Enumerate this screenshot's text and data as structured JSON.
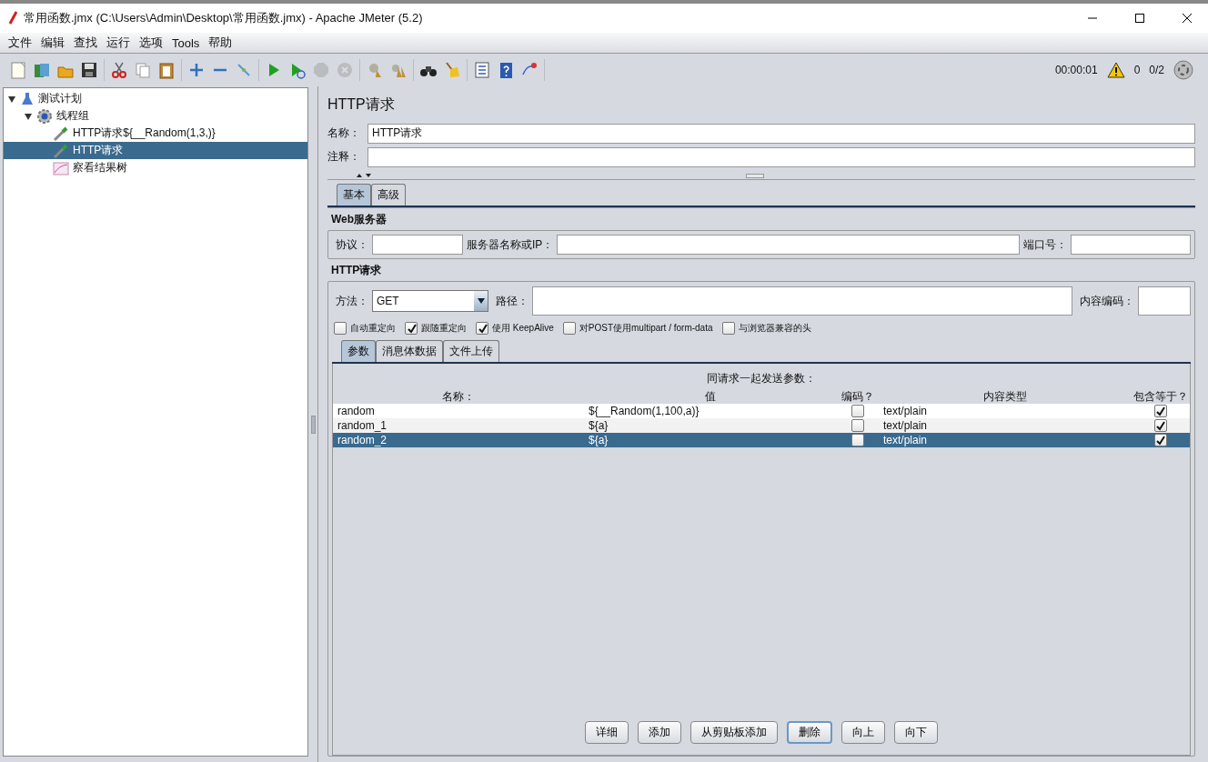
{
  "window": {
    "title": "常用函数.jmx (C:\\Users\\Admin\\Desktop\\常用函数.jmx) - Apache JMeter (5.2)"
  },
  "menu": [
    "文件",
    "编辑",
    "查找",
    "运行",
    "选项",
    "Tools",
    "帮助"
  ],
  "toolbar": [
    {
      "items": [
        {
          "kind": "new",
          "disabled": false
        },
        {
          "kind": "templates",
          "disabled": false
        },
        {
          "kind": "open",
          "disabled": false
        },
        {
          "kind": "save",
          "disabled": false
        }
      ]
    },
    {
      "items": [
        {
          "kind": "cut",
          "disabled": false
        },
        {
          "kind": "copy",
          "disabled": false
        },
        {
          "kind": "paste",
          "disabled": false
        }
      ]
    },
    {
      "items": [
        {
          "kind": "expand",
          "disabled": false
        },
        {
          "kind": "collapse",
          "disabled": false
        },
        {
          "kind": "toggle",
          "disabled": false
        }
      ]
    },
    {
      "items": [
        {
          "kind": "start",
          "disabled": false
        },
        {
          "kind": "start-no-timers",
          "disabled": false
        },
        {
          "kind": "stop",
          "disabled": true
        },
        {
          "kind": "shutdown",
          "disabled": true
        }
      ]
    },
    {
      "items": [
        {
          "kind": "clear",
          "disabled": false
        },
        {
          "kind": "clear-all",
          "disabled": false
        }
      ]
    },
    {
      "items": [
        {
          "kind": "search",
          "disabled": false
        },
        {
          "kind": "reset-search",
          "disabled": false
        }
      ]
    },
    {
      "items": [
        {
          "kind": "log",
          "disabled": false
        },
        {
          "kind": "help",
          "disabled": false
        },
        {
          "kind": "function",
          "disabled": false
        }
      ]
    }
  ],
  "status": {
    "timer": "00:00:01",
    "warnings": "0",
    "threads": "0/2"
  },
  "tree": [
    {
      "label": "测试计划",
      "kind": "plan",
      "expanded": true,
      "selected": false,
      "children": [
        {
          "label": "线程组",
          "kind": "thread-group",
          "expanded": true,
          "selected": false,
          "children": [
            {
              "label": "HTTP请求${__Random(1,3,)}",
              "kind": "sampler",
              "selected": false
            },
            {
              "label": "HTTP请求",
              "kind": "sampler",
              "selected": true
            },
            {
              "label": "察看结果树",
              "kind": "listener",
              "selected": false
            }
          ]
        }
      ]
    }
  ],
  "panel": {
    "title": "HTTP请求",
    "name_field": {
      "label": "名称：",
      "value": "HTTP请求"
    },
    "comment_field": {
      "label": "注释："
    },
    "tabs": [
      {
        "label": "基本",
        "selected": true
      },
      {
        "label": "高级",
        "selected": false
      }
    ],
    "web_server": {
      "title": "Web服务器",
      "fields": [
        {
          "label": "协议："
        },
        {
          "label": "服务器名称或IP："
        },
        {
          "label": "端口号："
        }
      ]
    },
    "http_request": {
      "title": "HTTP请求",
      "method": {
        "label": "方法：",
        "value": "GET"
      },
      "path": {
        "label": "路径："
      },
      "encoding": {
        "label": "内容编码："
      },
      "options": [
        {
          "label": "自动重定向",
          "checked": false
        },
        {
          "label": "跟随重定向",
          "checked": true
        },
        {
          "label": "使用 KeepAlive",
          "checked": true
        },
        {
          "label": "对POST使用multipart / form-data",
          "checked": false
        },
        {
          "label": "与浏览器兼容的头",
          "checked": false
        }
      ]
    },
    "sub_tabs": [
      {
        "label": "参数",
        "selected": true
      },
      {
        "label": "消息体数据",
        "selected": false
      },
      {
        "label": "文件上传",
        "selected": false
      }
    ],
    "table": {
      "caption": "同请求一起发送参数：",
      "columns": [
        "名称：",
        "值",
        "编码？",
        "内容类型",
        "包含等于？"
      ],
      "rows": [
        {
          "name": "random",
          "value": "${__Random(1,100,a)}",
          "encode": false,
          "content_type": "text/plain",
          "include_equals": true,
          "selected": false
        },
        {
          "name": "random_1",
          "value": "${a}",
          "encode": false,
          "content_type": "text/plain",
          "include_equals": true,
          "selected": false
        },
        {
          "name": "random_2",
          "value": "${a}",
          "encode": false,
          "content_type": "text/plain",
          "include_equals": true,
          "selected": true
        }
      ]
    },
    "buttons": [
      {
        "label": "详细",
        "focused": false
      },
      {
        "label": "添加",
        "focused": false
      },
      {
        "label": "从剪贴板添加",
        "focused": false
      },
      {
        "label": "删除",
        "focused": true
      },
      {
        "label": "向上",
        "focused": false
      },
      {
        "label": "向下",
        "focused": false
      }
    ]
  }
}
